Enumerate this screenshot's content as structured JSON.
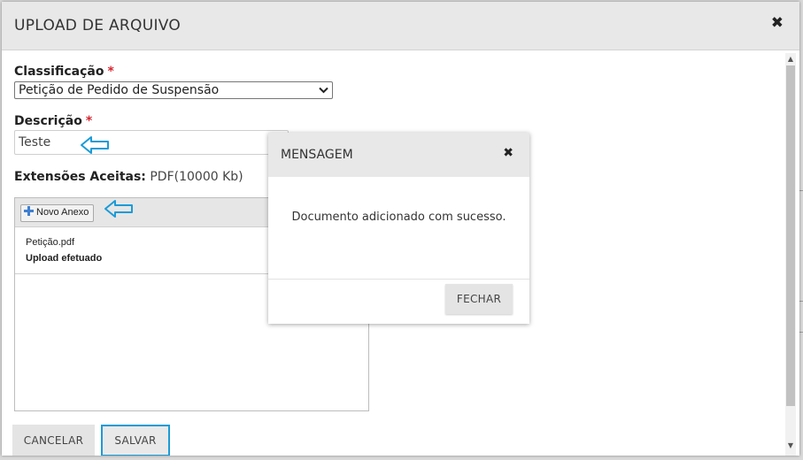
{
  "dialog": {
    "title": "UPLOAD DE ARQUIVO",
    "close_symbol": "✖"
  },
  "form": {
    "classificacao_label": "Classificação",
    "classificacao_value": "Petição de Pedido de Suspensão",
    "descricao_label": "Descrição",
    "descricao_value": "Teste",
    "required_mark": "*",
    "extensoes_label": "Extensões Aceitas:",
    "extensoes_value": "PDF(10000 Kb)"
  },
  "upload": {
    "button_label": "Novo Anexo",
    "files": [
      {
        "name": "Petição.pdf",
        "status": "Upload efetuado"
      }
    ]
  },
  "footer": {
    "cancel_label": "CANCELAR",
    "save_label": "SALVAR"
  },
  "message": {
    "title": "MENSAGEM",
    "close_symbol": "✖",
    "text": "Documento adicionado com sucesso.",
    "button_label": "FECHAR"
  },
  "colors": {
    "accent_highlight": "#1b9bd7",
    "required": "#d9232d",
    "header_bg": "#e8e8e8"
  },
  "icons": [
    "close-icon",
    "chevron-down-icon",
    "plus-icon",
    "arrow-left-icon",
    "scroll-up-icon",
    "scroll-down-icon"
  ]
}
